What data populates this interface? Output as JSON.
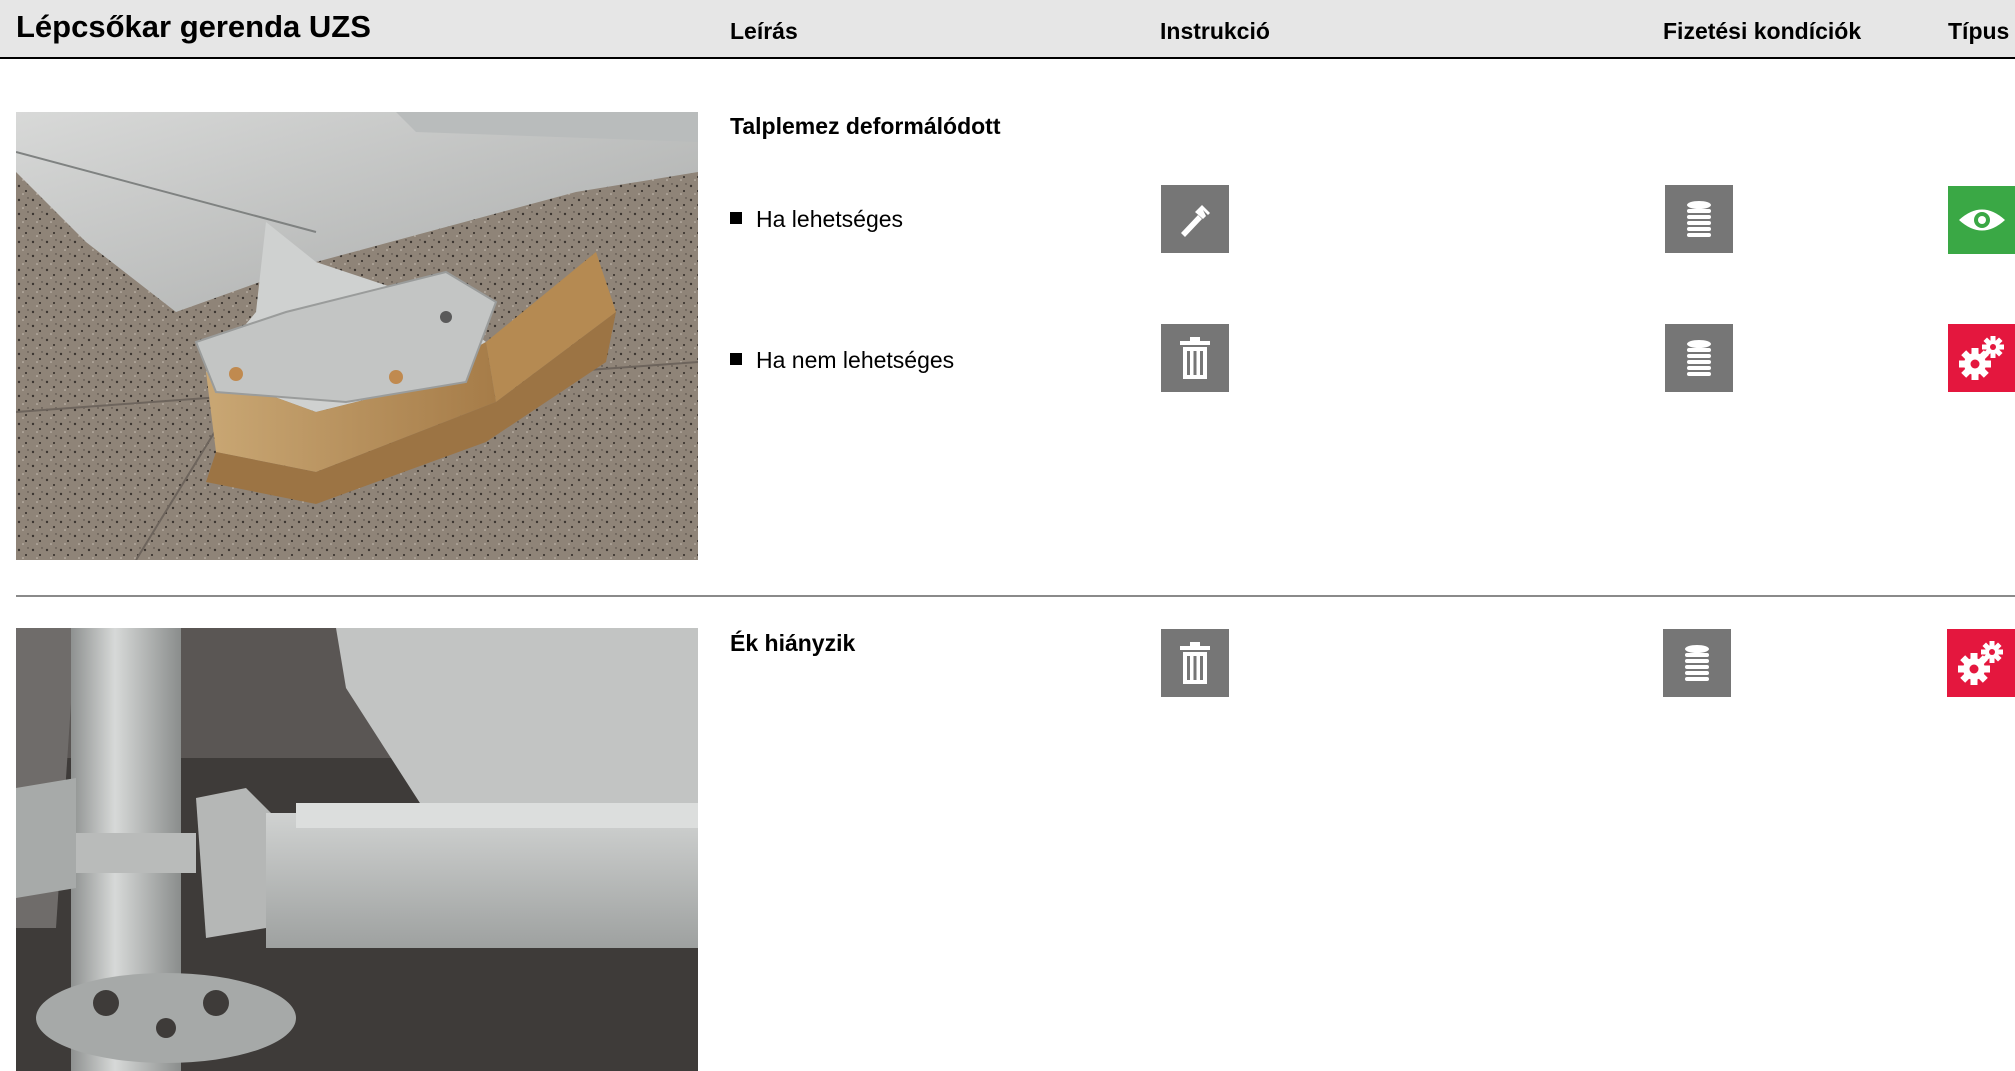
{
  "header": {
    "title": "Lépcsőkar gerenda UZS",
    "columns": {
      "description": "Leírás",
      "instruction": "Instrukció",
      "payment": "Fizetési kondíciók",
      "type": "Típus"
    }
  },
  "rows": [
    {
      "title": "Talplemez deformálódott",
      "photo": "bent-base-plate-photo",
      "options": [
        {
          "label": "Ha lehetséges",
          "instruction_icon": "hammer-icon",
          "payment_icon": "coin-stack-icon",
          "type_icon": "eye-icon",
          "type_color": "#3aa845"
        },
        {
          "label": "Ha nem lehetséges",
          "instruction_icon": "trash-icon",
          "payment_icon": "coin-stack-icon",
          "type_icon": "gears-icon",
          "type_color": "#e4173e"
        }
      ]
    },
    {
      "title": "Ék hiányzik",
      "photo": "missing-wedge-photo",
      "instruction_icon": "trash-icon",
      "payment_icon": "coin-stack-icon",
      "type_icon": "gears-icon",
      "type_color": "#e4173e"
    }
  ],
  "colors": {
    "icon_gray": "#767676",
    "green": "#3aa845",
    "red": "#e4173e",
    "header_bg": "#e6e6e6"
  }
}
